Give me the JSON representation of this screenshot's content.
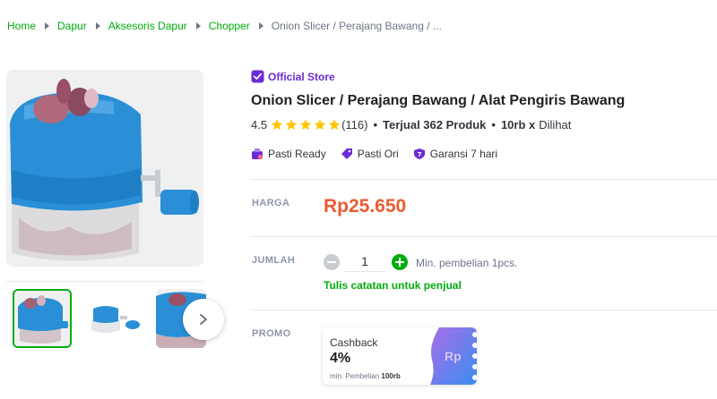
{
  "breadcrumb": [
    {
      "label": "Home"
    },
    {
      "label": "Dapur"
    },
    {
      "label": "Aksesoris Dapur"
    },
    {
      "label": "Chopper"
    },
    {
      "label": "Onion Slicer / Perajang Bawang / ..."
    }
  ],
  "product": {
    "store_badge": "Official Store",
    "title": "Onion Slicer / Perajang Bawang / Alat Pengiris Bawang",
    "rating": "4.5",
    "stars": 5,
    "review_count": "(116)",
    "sold_text": "Terjual 362 Produk",
    "views_bold": "10rb x",
    "views_text": "Dilihat",
    "badges": [
      {
        "icon": "ready-icon",
        "label": "Pasti Ready"
      },
      {
        "icon": "original-tag-icon",
        "label": "Pasti Ori"
      },
      {
        "icon": "warranty-icon",
        "label": "Garansi 7 hari"
      }
    ]
  },
  "price": {
    "label": "HARGA",
    "value": "Rp25.650"
  },
  "quantity": {
    "label": "JUMLAH",
    "value": "1",
    "min_text": "Min. pembelian 1pcs.",
    "note_link": "Tulis catatan untuk penjual"
  },
  "promo": {
    "label": "PROMO",
    "type": "Cashback",
    "value": "4%",
    "min_prefix": "min. Pembelian",
    "min_amount": "100rb",
    "art_text": "Rp"
  },
  "colors": {
    "brand_green": "#03ac0e",
    "price_orange": "#e95b31",
    "official_purple": "#6b2bd6",
    "star_yellow": "#ffc400",
    "product_blue": "#2a8fd6"
  }
}
